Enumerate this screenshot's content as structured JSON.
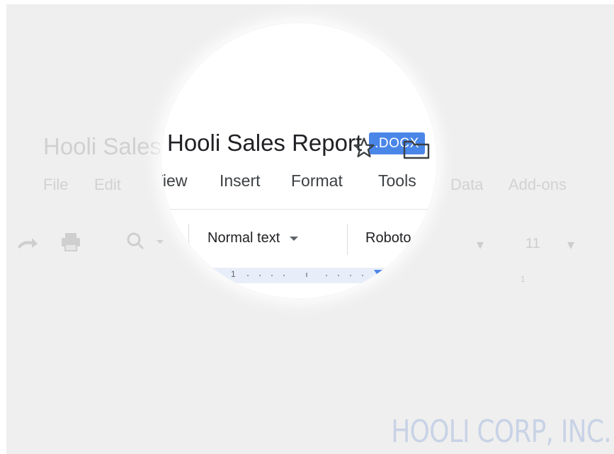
{
  "document": {
    "title": "Hooli Sales Report",
    "extension_badge": ".DOCX"
  },
  "icons": {
    "star": "star-icon",
    "folder": "folder-icon",
    "redo": "redo-icon",
    "print": "print-icon",
    "zoom": "zoom-icon"
  },
  "menu": [
    "File",
    "Edit",
    "View",
    "Insert",
    "Format",
    "Tools",
    "Data",
    "Add-ons"
  ],
  "toolbar": {
    "paragraph_style": "Normal text",
    "font": "Roboto",
    "font_size": "11"
  },
  "ruler": {
    "label": "1",
    "label_right": "1"
  },
  "watermark": "HOOLI CORP, INC.",
  "colors": {
    "badge": "#4a86e8",
    "background": "#efefef",
    "watermark": "#c9d3e6"
  }
}
